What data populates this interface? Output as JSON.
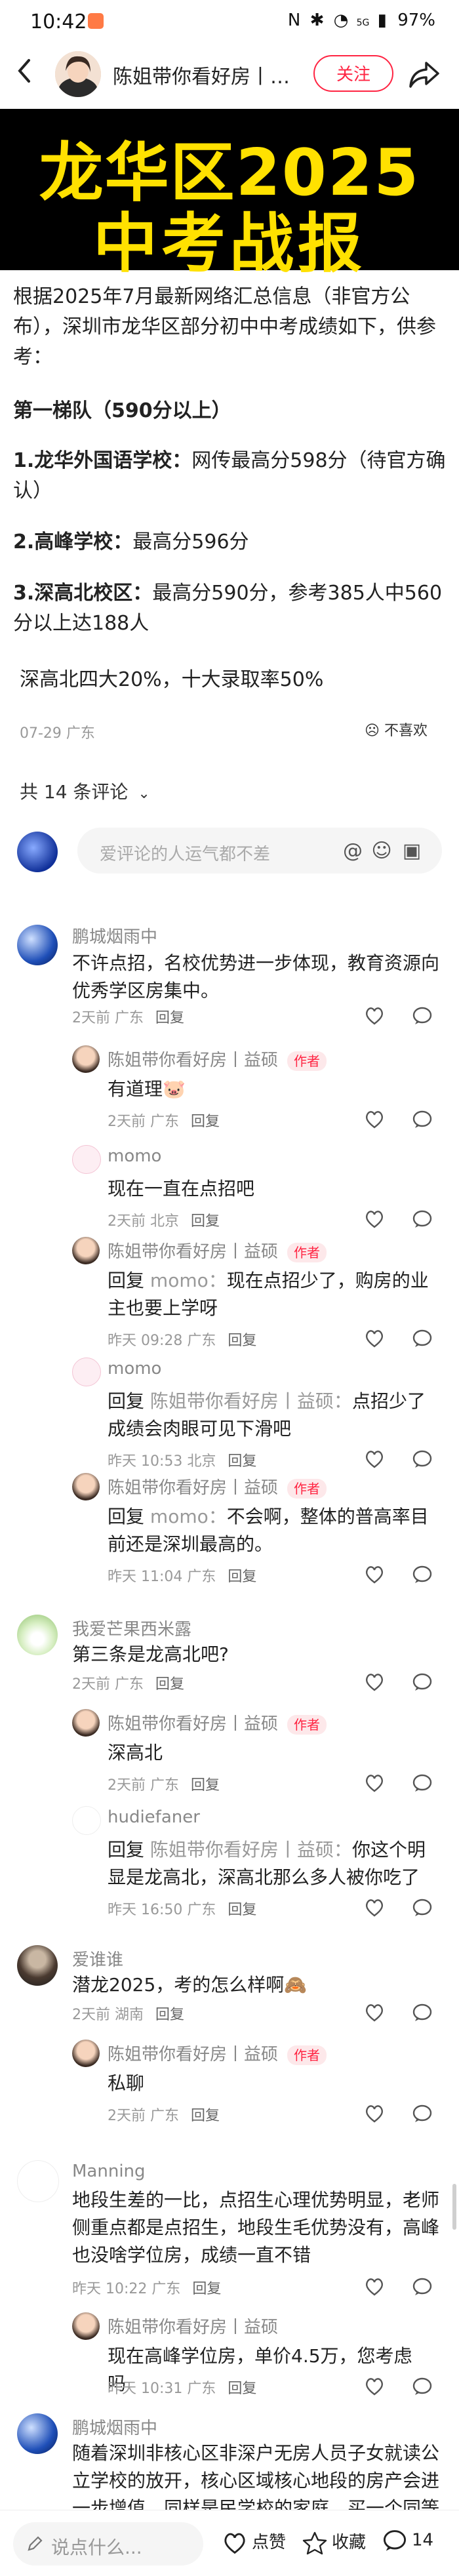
{
  "status_bar": {
    "time": "10:42",
    "signal": "5G",
    "battery": "97%"
  },
  "header": {
    "author_name": "陈姐带你看好房丨…",
    "follow_label": "关注"
  },
  "cover": {
    "line1": "龙华区2025",
    "line2": "中考战报"
  },
  "post": {
    "intro": "根据2025年7月最新网络汇总信息（非官方公布），深圳市龙华区部分初中中考成绩如下，供参考：",
    "tier_title": "第一梯队（590分以上）",
    "items": [
      {
        "num": "1.",
        "school": "龙华外国语学校：",
        "detail": "网传最高分598分（待官方确认）"
      },
      {
        "num": "2.",
        "school": "高峰学校：",
        "detail": "最高分596分"
      },
      {
        "num": "3.",
        "school": "深高北校区：",
        "detail": "最高分590分，参考385人中560分以上达188人"
      }
    ],
    "ratio": "深高北四大20%，十大录取率50%",
    "meta": "07-29 广东",
    "dislike_label": "不喜欢"
  },
  "comments_header": "共 14 条评论",
  "comment_input_placeholder": "爱评论的人运气都不差",
  "comments": [
    {
      "name": "鹏城烟雨中",
      "text": "不许点招，名校优势进一步体现，教育资源向优秀学区房集中。",
      "meta": "2天前 广东",
      "reply": "回复"
    },
    {
      "name": "陈姐带你看好房丨益硕",
      "tag": "作者",
      "text": "有道理🐷",
      "meta": "2天前 广东",
      "reply": "回复"
    },
    {
      "name": "momo",
      "text": "现在一直在点招吧",
      "meta": "2天前 北京",
      "reply": "回复"
    },
    {
      "name": "陈姐带你看好房丨益硕",
      "tag": "作者",
      "prefix": "回复",
      "quote": "momo：",
      "text": "现在点招少了，购房的业主也要上学呀",
      "meta": "昨天 09:28 广东",
      "reply": "回复"
    },
    {
      "name": "momo",
      "prefix": "回复",
      "quote": "陈姐带你看好房丨益硕：",
      "text": "点招少了成绩会肉眼可见下滑吧",
      "meta": "昨天 10:53 北京",
      "reply": "回复"
    },
    {
      "name": "陈姐带你看好房丨益硕",
      "tag": "作者",
      "prefix": "回复",
      "quote": "momo：",
      "text": "不会啊，整体的普高率目前还是深圳最高的。",
      "meta": "昨天 11:04 广东",
      "reply": "回复"
    },
    {
      "name": "我爱芒果西米露",
      "text": "第三条是龙高北吧?",
      "meta": "2天前 广东",
      "reply": "回复"
    },
    {
      "name": "陈姐带你看好房丨益硕",
      "tag": "作者",
      "text": "深高北",
      "meta": "2天前 广东",
      "reply": "回复"
    },
    {
      "name": "hudiefaner",
      "prefix": "回复",
      "quote": "陈姐带你看好房丨益硕：",
      "text": "你这个明显是龙高北，深高北那么多人被你吃了",
      "meta": "昨天 16:50 广东",
      "reply": "回复"
    },
    {
      "name": "爱谁谁",
      "text": "潜龙2025，考的怎么样啊🙈",
      "meta": "2天前 湖南",
      "reply": "回复"
    },
    {
      "name": "陈姐带你看好房丨益硕",
      "tag": "作者",
      "text": "私聊",
      "meta": "2天前 广东",
      "reply": "回复"
    },
    {
      "name": "Manning",
      "text": "地段生差的一比，点招生心理优势明显，老师侧重点都是点招生，地段生毛优势没有，高峰也没啥学位房，成绩一直不错",
      "meta": "昨天 10:22 广东",
      "reply": "回复"
    },
    {
      "name": "陈姐带你看好房丨益硕",
      "text": "现在高峰学位房，单价4.5万，您考虑吗",
      "meta": "昨天 10:31 广东",
      "reply": "回复"
    },
    {
      "name": "鹏城烟雨中",
      "text": "随着深圳非核心区非深户无房人员子女就读公立学校的放开，核心区域核心地段的房产会进一步增值，同样是民学校的家庭，买一个同等"
    }
  ],
  "bottom_bar": {
    "input_placeholder": "说点什么...",
    "like_label": "点赞",
    "collect_label": "收藏",
    "comment_count": "14"
  }
}
